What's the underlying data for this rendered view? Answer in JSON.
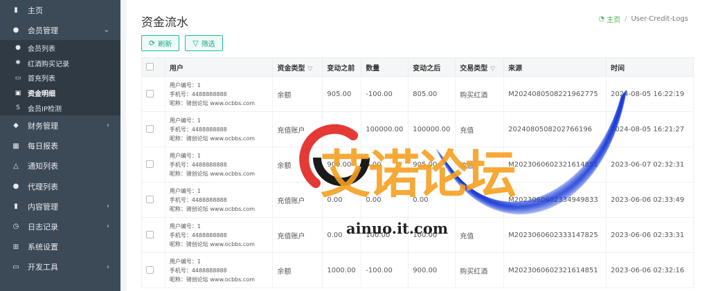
{
  "sidebar": {
    "items": [
      {
        "label": "主页",
        "icon": "dashboard-icon",
        "glyph": "▮",
        "chevron": ""
      },
      {
        "label": "会员管理",
        "icon": "user-icon",
        "glyph": "●",
        "chevron": "⌄"
      },
      {
        "label": "财务管理",
        "icon": "money-icon",
        "glyph": "◆",
        "chevron": "‹"
      },
      {
        "label": "每日报表",
        "icon": "calendar-icon",
        "glyph": "▦",
        "chevron": ""
      },
      {
        "label": "通知列表",
        "icon": "bell-icon",
        "glyph": "△",
        "chevron": ""
      },
      {
        "label": "代理列表",
        "icon": "circle-icon",
        "glyph": "●",
        "chevron": ""
      },
      {
        "label": "内容管理",
        "icon": "bookmark-icon",
        "glyph": "▮",
        "chevron": "‹"
      },
      {
        "label": "日志记录",
        "icon": "clock-icon",
        "glyph": "◷",
        "chevron": "‹"
      },
      {
        "label": "系统设置",
        "icon": "windows-icon",
        "glyph": "⊞",
        "chevron": ""
      },
      {
        "label": "开发工具",
        "icon": "keyboard-icon",
        "glyph": "▭",
        "chevron": "‹"
      }
    ],
    "submenu": [
      {
        "label": "会员列表",
        "icon": "user-icon",
        "glyph": "●"
      },
      {
        "label": "红酒购买记录",
        "icon": "bug-icon",
        "glyph": "✱"
      },
      {
        "label": "首充列表",
        "icon": "card-icon",
        "glyph": "▭"
      },
      {
        "label": "资金明细",
        "icon": "money-icon",
        "glyph": "▣"
      },
      {
        "label": "会员IP检测",
        "icon": "skype-icon",
        "glyph": "S"
      }
    ]
  },
  "header": {
    "title": "资金流水",
    "breadcrumb_home": "主页",
    "breadcrumb_current": "User-Credit-Logs"
  },
  "toolbar": {
    "refresh_label": "刷新",
    "filter_label": "筛选"
  },
  "table": {
    "columns": [
      "用户",
      "资金类型",
      "变动之前",
      "数量",
      "变动之后",
      "交易类型",
      "来源",
      "时间"
    ],
    "user_labels": {
      "id": "用户编号：",
      "phone": "手机号：",
      "nick": "昵称："
    },
    "rows": [
      {
        "user_id": "1",
        "phone": "4488888888",
        "nick": "骑创论坛 www.ocbbs.com",
        "type": "余额",
        "before": "905.00",
        "amount": "-100.00",
        "after": "805.00",
        "trade": "购买红酒",
        "source": "M2024080508221962775",
        "time": "2024-08-05 16:22:19"
      },
      {
        "user_id": "1",
        "phone": "4488888888",
        "nick": "骑创论坛 www.ocbbs.com",
        "type": "充值账户",
        "before": "0.00",
        "amount": "100000.00",
        "after": "100000.00",
        "trade": "充值",
        "source": "2024080508202766196",
        "time": "2024-08-05 16:21:27"
      },
      {
        "user_id": "1",
        "phone": "4488888888",
        "nick": "骑创论坛 www.ocbbs.com",
        "type": "余额",
        "before": "900.00",
        "amount": "5.00",
        "after": "905.00",
        "trade": "收益",
        "source": "M2023060602321614851",
        "time": "2023-06-07 02:32:31"
      },
      {
        "user_id": "1",
        "phone": "4488888888",
        "nick": "骑创论坛 www.ocbbs.com",
        "type": "充值账户",
        "before": "0.00",
        "amount": "0.00",
        "after": "0.00",
        "trade": "",
        "source": "M2023060602334949833",
        "time": "2023-06-06 02:33:49"
      },
      {
        "user_id": "1",
        "phone": "4488888888",
        "nick": "骑创论坛 www.ocbbs.com",
        "type": "充值账户",
        "before": "0.00",
        "amount": "100.00",
        "after": "100.00",
        "trade": "充值",
        "source": "M2023060602333147825",
        "time": "2023-06-06 02:33:31"
      },
      {
        "user_id": "1",
        "phone": "4488888888",
        "nick": "骑创论坛 www.ocbbs.com",
        "type": "余额",
        "before": "1000.00",
        "amount": "-100.00",
        "after": "900.00",
        "trade": "购买红酒",
        "source": "M2023060602321614851",
        "time": "2023-06-06 02:32:16"
      }
    ]
  },
  "watermark": {
    "title": "艾诺论坛",
    "domain": "ainuo.it.com",
    "red": "#e53935",
    "orange": "#f5a020",
    "blue": "#1a3cd8"
  }
}
